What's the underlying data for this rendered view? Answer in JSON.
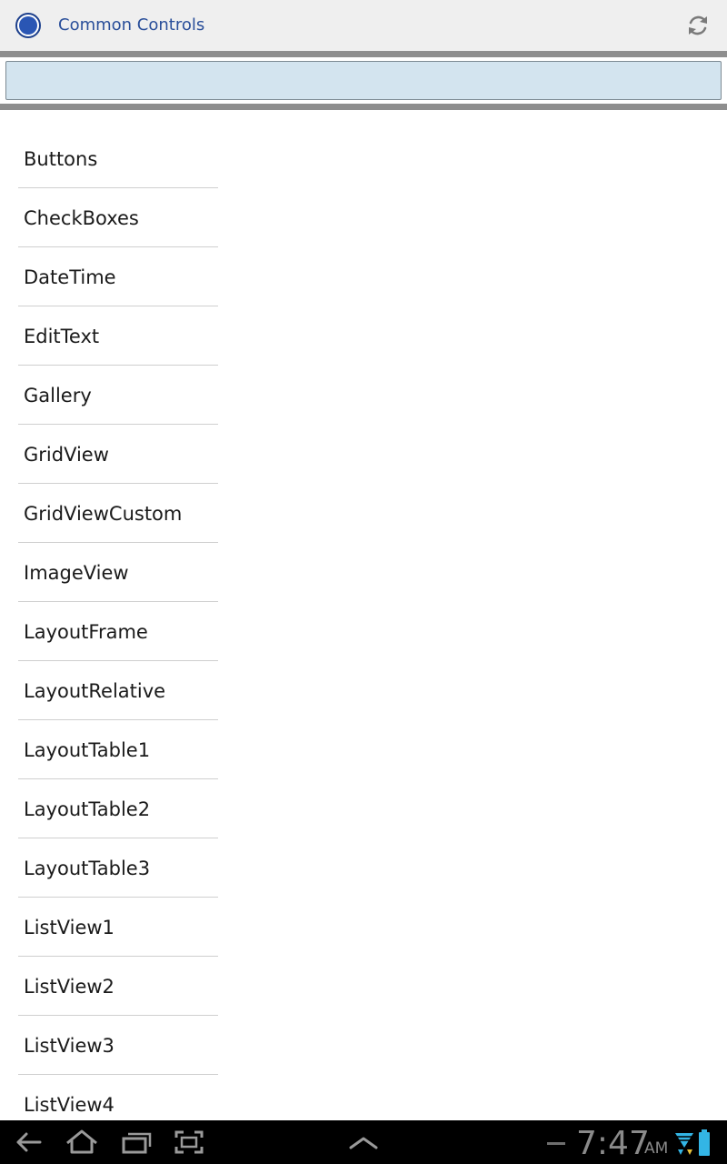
{
  "app": {
    "title": "Common Controls",
    "accent_color": "#2a56b4",
    "title_color": "#2a4f9a"
  },
  "search": {
    "value": "",
    "placeholder": ""
  },
  "list": {
    "items": [
      {
        "label": "Buttons"
      },
      {
        "label": "CheckBoxes"
      },
      {
        "label": "DateTime"
      },
      {
        "label": "EditText"
      },
      {
        "label": "Gallery"
      },
      {
        "label": "GridView"
      },
      {
        "label": "GridViewCustom"
      },
      {
        "label": "ImageView"
      },
      {
        "label": "LayoutFrame"
      },
      {
        "label": "LayoutRelative"
      },
      {
        "label": "LayoutTable1"
      },
      {
        "label": "LayoutTable2"
      },
      {
        "label": "LayoutTable3"
      },
      {
        "label": "ListView1"
      },
      {
        "label": "ListView2"
      },
      {
        "label": "ListView3"
      },
      {
        "label": "ListView4"
      }
    ]
  },
  "navbar": {
    "icons": [
      "back-icon",
      "home-icon",
      "recent-apps-icon",
      "screenshot-icon",
      "chevron-up-icon"
    ]
  },
  "status": {
    "time": "7:47",
    "ampm": "AM",
    "icons": [
      "wifi-icon",
      "battery-icon"
    ]
  }
}
